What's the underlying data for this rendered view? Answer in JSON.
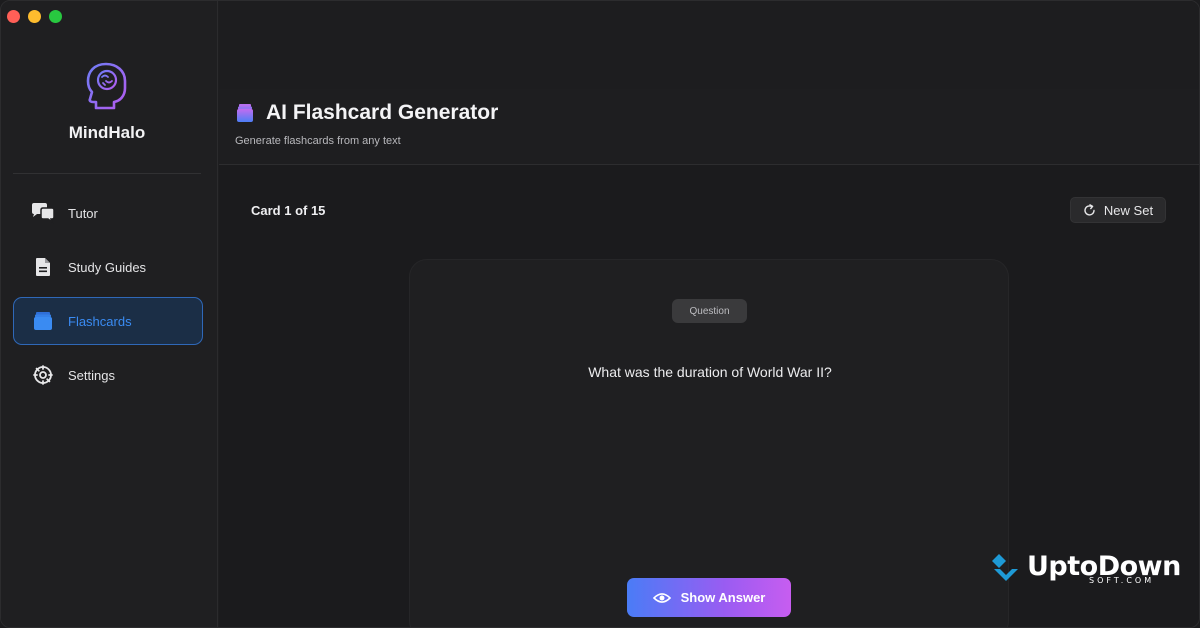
{
  "app": {
    "brand_name": "MindHalo"
  },
  "sidebar": {
    "items": [
      {
        "label": "Tutor",
        "icon": "chat-bubbles-icon",
        "active": false
      },
      {
        "label": "Study Guides",
        "icon": "document-icon",
        "active": false
      },
      {
        "label": "Flashcards",
        "icon": "cards-icon",
        "active": true
      },
      {
        "label": "Settings",
        "icon": "gear-icon",
        "active": false
      }
    ]
  },
  "header": {
    "title": "AI Flashcard Generator",
    "subtitle": "Generate flashcards from any text"
  },
  "toolbar": {
    "card_count": "Card 1 of 15",
    "new_set_label": "New Set"
  },
  "card": {
    "side_label": "Question",
    "text": "What was the duration of World War II?"
  },
  "actions": {
    "show_answer_label": "Show Answer"
  },
  "watermark": {
    "main": "UptoDown",
    "sub": "SOFT.COM"
  },
  "colors": {
    "accent": "#3a8bf2",
    "active_bg": "#1b2e46",
    "button_gradient_start": "#4a7cf6",
    "button_gradient_end": "#c75df0",
    "watermark_blue": "#1e9ad6"
  }
}
